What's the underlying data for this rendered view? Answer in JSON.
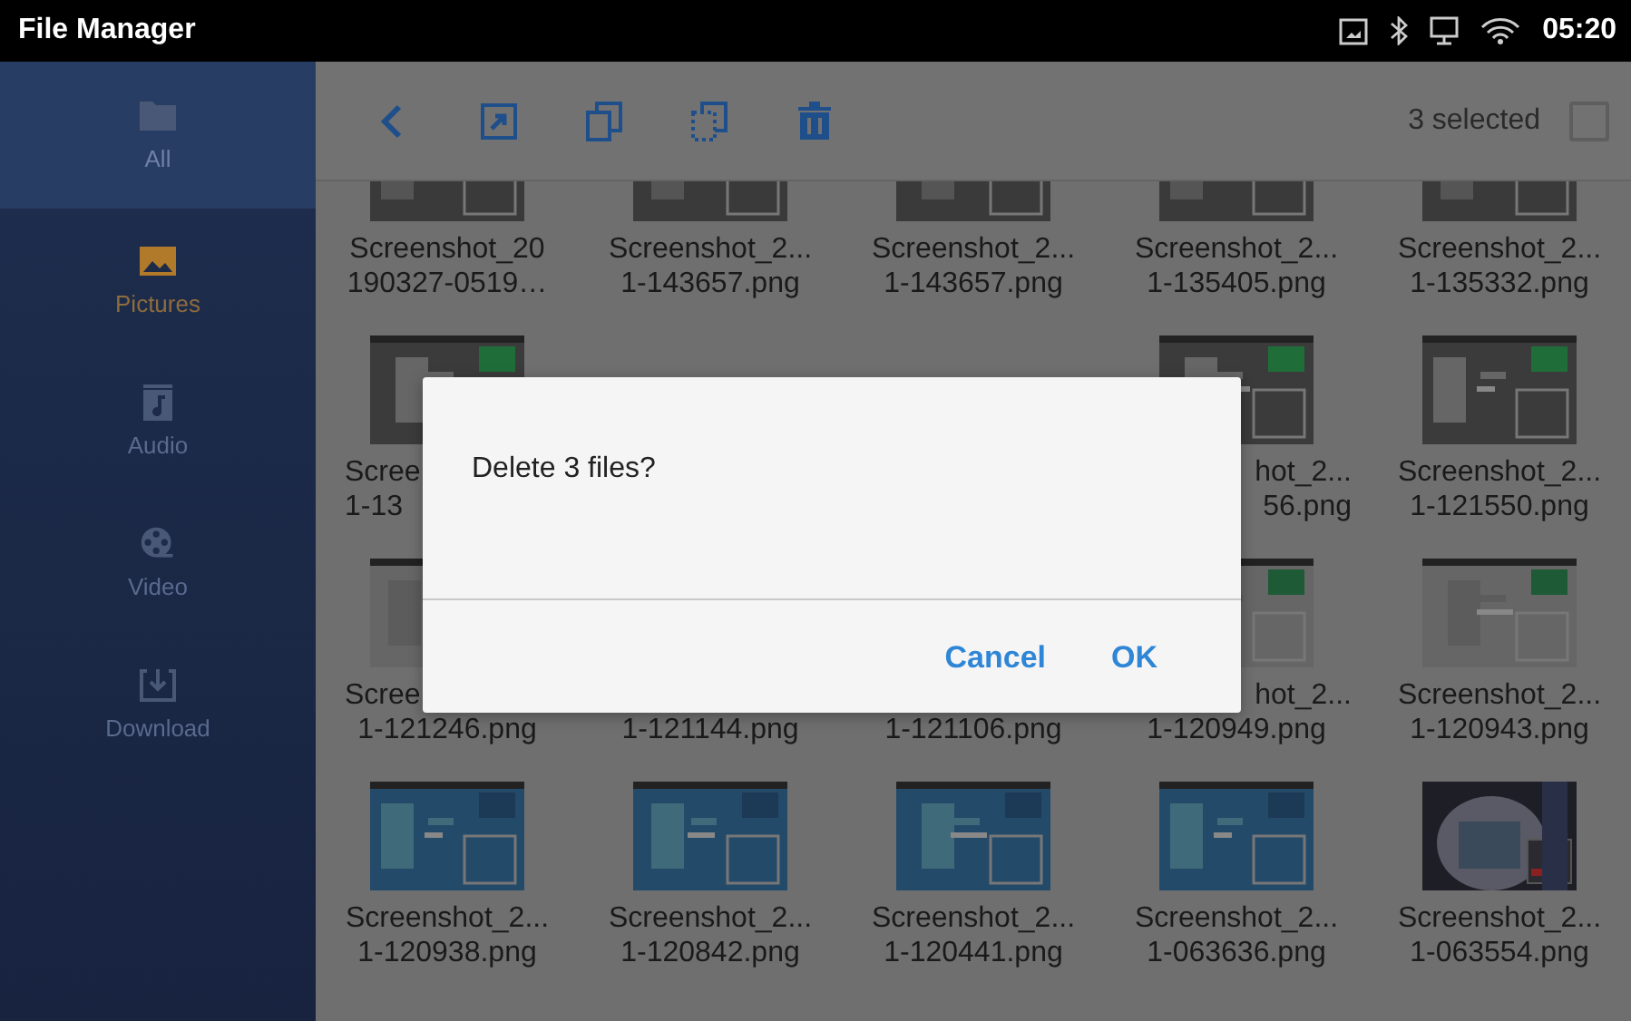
{
  "window": {
    "title": "File Manager"
  },
  "status_bar": {
    "time": "05:20"
  },
  "sidebar": {
    "items": [
      {
        "label": "All",
        "kind": "folder",
        "selected": false,
        "highlighted": true
      },
      {
        "label": "Pictures",
        "kind": "pictures",
        "selected": true,
        "highlighted": false
      },
      {
        "label": "Audio",
        "kind": "audio",
        "selected": false,
        "highlighted": false
      },
      {
        "label": "Video",
        "kind": "video",
        "selected": false,
        "highlighted": false
      },
      {
        "label": "Download",
        "kind": "download",
        "selected": false,
        "highlighted": false
      }
    ]
  },
  "toolbar": {
    "count": "3 selected",
    "select_all_checked": false
  },
  "files": [
    [
      {
        "lines": [
          {
            "text": "Screenshot_20",
            "kind": "whole"
          },
          {
            "text": "190327-0519…",
            "kind": "whole"
          }
        ]
      },
      {
        "lines": [
          {
            "text": "Screenshot_2...",
            "kind": "whole"
          },
          {
            "text": "1-143657.png",
            "kind": "whole"
          }
        ]
      },
      {
        "lines": [
          {
            "text": "Screenshot_2...",
            "kind": "whole"
          },
          {
            "text": "1-143657.png",
            "kind": "whole"
          }
        ]
      },
      {
        "lines": [
          {
            "text": "Screenshot_2...",
            "kind": "whole"
          },
          {
            "text": "1-135405.png",
            "kind": "whole"
          }
        ]
      },
      {
        "lines": [
          {
            "text": "Screenshot_2...",
            "kind": "whole"
          },
          {
            "text": "1-135332.png",
            "kind": "whole"
          }
        ]
      }
    ],
    [
      {
        "lines": [
          {
            "text": "Scree",
            "kind": "cut-end"
          },
          {
            "text": "1-13",
            "kind": "cut-end"
          }
        ]
      },
      {
        "lines": [
          {
            "kind": "hidden"
          },
          {
            "kind": "hidden"
          }
        ]
      },
      {
        "lines": [
          {
            "kind": "hidden"
          },
          {
            "kind": "hidden"
          }
        ]
      },
      {
        "lines": [
          {
            "text": "hot_2...",
            "kind": "cut-start"
          },
          {
            "text": "56.png",
            "kind": "cut-start"
          }
        ]
      },
      {
        "lines": [
          {
            "text": "Screenshot_2...",
            "kind": "whole"
          },
          {
            "text": "1-121550.png",
            "kind": "whole"
          }
        ]
      }
    ],
    [
      {
        "lines": [
          {
            "text": "Scree",
            "kind": "cut-end"
          },
          {
            "text": "1-121246.png",
            "kind": "whole"
          }
        ]
      },
      {
        "lines": [
          {
            "kind": "hidden"
          },
          {
            "text": "1-121144.png",
            "kind": "whole"
          }
        ]
      },
      {
        "lines": [
          {
            "kind": "hidden"
          },
          {
            "text": "1-121106.png",
            "kind": "whole"
          }
        ]
      },
      {
        "lines": [
          {
            "text": "hot_2...",
            "kind": "cut-start"
          },
          {
            "text": "1-120949.png",
            "kind": "whole"
          }
        ]
      },
      {
        "lines": [
          {
            "text": "Screenshot_2...",
            "kind": "whole"
          },
          {
            "text": "1-120943.png",
            "kind": "whole"
          }
        ]
      }
    ],
    [
      {
        "lines": [
          {
            "text": "Screenshot_2...",
            "kind": "whole"
          },
          {
            "text": "1-120938.png",
            "kind": "whole"
          }
        ]
      },
      {
        "lines": [
          {
            "text": "Screenshot_2...",
            "kind": "whole"
          },
          {
            "text": "1-120842.png",
            "kind": "whole"
          }
        ]
      },
      {
        "lines": [
          {
            "text": "Screenshot_2...",
            "kind": "whole"
          },
          {
            "text": "1-120441.png",
            "kind": "whole"
          }
        ]
      },
      {
        "lines": [
          {
            "text": "Screenshot_2...",
            "kind": "whole"
          },
          {
            "text": "1-063636.png",
            "kind": "whole"
          }
        ]
      },
      {
        "lines": [
          {
            "text": "Screenshot_2...",
            "kind": "whole"
          },
          {
            "text": "1-063554.png",
            "kind": "whole"
          }
        ]
      }
    ]
  ],
  "dialog": {
    "message": "Delete 3 files?",
    "buttons": [
      "Cancel",
      "OK"
    ]
  }
}
